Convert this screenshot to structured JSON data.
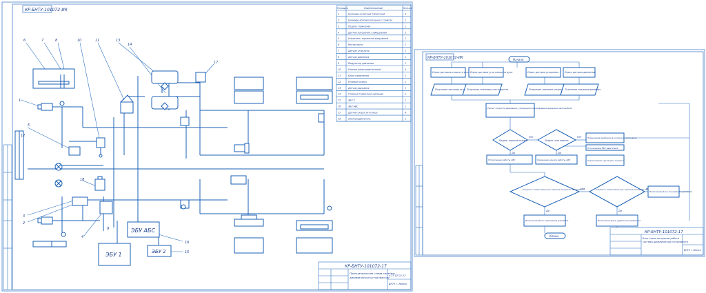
{
  "left_sheet": {
    "stamp_code": "КР-БНТУ-101072-ИК",
    "title_block": {
      "code": "КР-БНТУ-101072-17",
      "title_line1": "Принципиальная схема системы",
      "title_line2": "динамической устойчивости",
      "group": "т.37 02 02-22",
      "org": "БНТУ г. Минск"
    },
    "units": {
      "abs": "ЭБУ АБС",
      "ebu1": "ЭБУ 1",
      "ebu2": "ЭБУ 2"
    },
    "callouts": [
      "1",
      "2",
      "3",
      "4",
      "5",
      "6",
      "7",
      "8",
      "9",
      "10",
      "11",
      "12",
      "13",
      "14",
      "15",
      "16",
      "17",
      "18"
    ],
    "spec_table": {
      "headers": [
        "Позиция",
        "Наименование",
        "Кол-во"
      ],
      "rows": [
        [
          "1",
          "Цилиндр колесный тормозной",
          "4"
        ],
        [
          "2",
          "Цилиндр вспомогательного тормоза",
          "1"
        ],
        [
          "3",
          "Педаль тормозная",
          "1"
        ],
        [
          "4",
          "Датчик ускорения / замедления",
          "1"
        ],
        [
          "5",
          "Усилитель тормозной вакуумный",
          "1"
        ],
        [
          "6",
          "Мотор-насос",
          "1"
        ],
        [
          "7",
          "Датчик угла руля",
          "1"
        ],
        [
          "8",
          "Датчик давления",
          "1"
        ],
        [
          "9",
          "Модулятор давления",
          "1"
        ],
        [
          "10",
          "Клапан электромагнитный",
          "4"
        ],
        [
          "11",
          "Блок управления",
          "1"
        ],
        [
          "12",
          "Рулевое колесо",
          "1"
        ],
        [
          "13",
          "Датчик рыскания",
          "1"
        ],
        [
          "14",
          "Главный тормозной цилиндр",
          "1"
        ],
        [
          "15",
          "ЭБУ 2",
          "1"
        ],
        [
          "16",
          "ЭБУ АБС",
          "1"
        ],
        [
          "17",
          "Датчик скорости колеса",
          "4"
        ],
        [
          "18",
          "Электродвигатель",
          "1"
        ]
      ]
    }
  },
  "right_sheet": {
    "stamp_code": "КР-БНТУ-101072-ИК",
    "start": "Начало",
    "end": "Конец",
    "inputs": [
      "Опрос датчиков скорости колес",
      "Опрос датчика угла поворота руля",
      "Опрос датчика ускорения",
      "Опрос датчика давления"
    ],
    "data_blocks": [
      "Получение значения скорости колес",
      "Получение значения угла поворота",
      "Получение значения ускорения",
      "Получение значения давления"
    ],
    "calc": "Расчет скорости движения, ускорения и направления движения автомобиля",
    "decisions": {
      "d1": "Педаль тормоза нажата",
      "d2": "Педаль газа нажата",
      "d3": "Скорость колеса больше / меньше скорости автомобиля",
      "d4": "Скорость колеса больше / меньше скорости автомобиля"
    },
    "actions": {
      "a1": "Повышение давления в колесных цилиндрах",
      "a2": "Отключение ЭБУ двигателя",
      "a3": "Отключение работы АБС",
      "a4": "Ожидание начала работы АБС",
      "a5": "Ограничение крутящего момента",
      "a6": "Включение фазы понижения давления",
      "a7": "Включение фазы повышения давления",
      "a8": "Включение фазы удержания давления"
    },
    "yes": "Да",
    "no": "Нет",
    "title_block": {
      "code": "КР-БНТУ-101072-17",
      "title_line1": "Блок-схема алгоритма работы",
      "title_line2": "системы динамической устойчивости",
      "org": "БНТУ г. Минск"
    }
  }
}
